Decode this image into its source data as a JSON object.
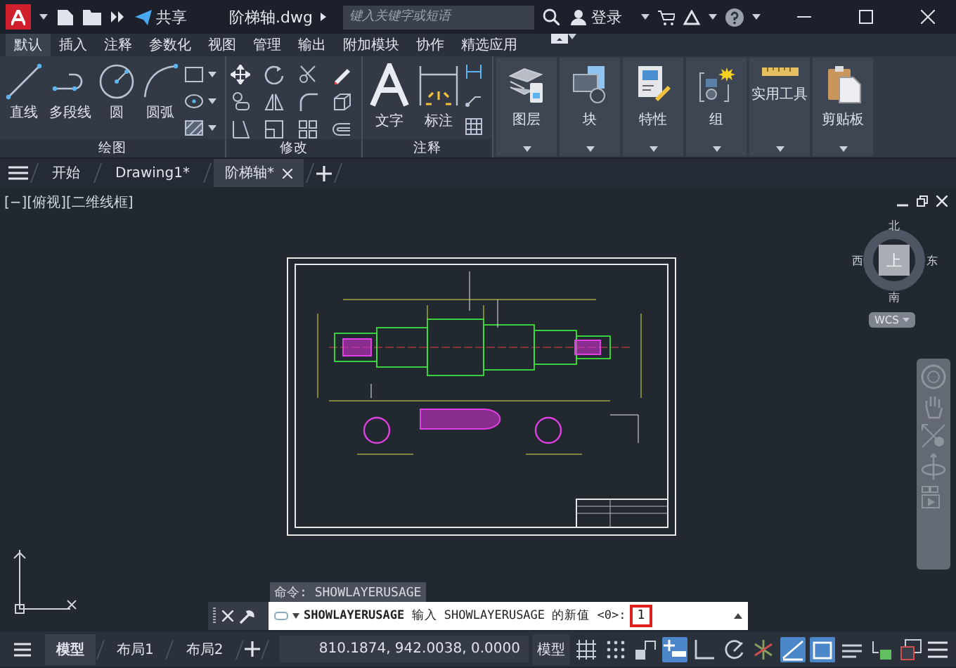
{
  "title_bar": {
    "share": "共享",
    "file_name": "阶梯轴.dwg",
    "search": {
      "placeholder": "键入关键字或短语"
    },
    "sign_in": "登录"
  },
  "ribbon_tabs": [
    {
      "label": "默认",
      "selected": true
    },
    {
      "label": "插入",
      "selected": false
    },
    {
      "label": "注释",
      "selected": false
    },
    {
      "label": "参数化",
      "selected": false
    },
    {
      "label": "视图",
      "selected": false
    },
    {
      "label": "管理",
      "selected": false
    },
    {
      "label": "输出",
      "selected": false
    },
    {
      "label": "附加模块",
      "selected": false
    },
    {
      "label": "协作",
      "selected": false
    },
    {
      "label": "精选应用",
      "selected": false
    }
  ],
  "draw_panel": {
    "title": "绘图",
    "tools": [
      {
        "kind": "line",
        "label": "直线"
      },
      {
        "kind": "polyline",
        "label": "多段线"
      },
      {
        "kind": "circle",
        "label": "圆"
      },
      {
        "kind": "arc",
        "label": "圆弧"
      }
    ]
  },
  "modify_panel": {
    "title": "修改"
  },
  "annotation_panel": {
    "title": "注释",
    "tools": [
      {
        "kind": "text",
        "label": "文字"
      },
      {
        "kind": "dimension",
        "label": "标注"
      }
    ]
  },
  "ribbon_buttons": [
    {
      "kind": "layers",
      "label": "图层"
    },
    {
      "kind": "block",
      "label": "块"
    },
    {
      "kind": "properties",
      "label": "特性"
    },
    {
      "kind": "group",
      "label": "组"
    },
    {
      "kind": "utilities",
      "label": "实用工具"
    },
    {
      "kind": "clipboard",
      "label": "剪贴板"
    }
  ],
  "doc_tabs": [
    {
      "label": "开始",
      "selected": false
    },
    {
      "label": "Drawing1*",
      "selected": false
    },
    {
      "label": "阶梯轴*",
      "selected": true
    }
  ],
  "viewport_label": "[−][俯视][二维线框]",
  "viewcube": {
    "north": "北",
    "west": "西",
    "face": "上",
    "east": "东",
    "south": "南",
    "ucs": "WCS"
  },
  "command_history": "命令: SHOWLAYERUSAGE",
  "command_line": {
    "prompt": "**SHOWLAYERUSAGE** 输入 SHOWLAYERUSAGE 的新值 <0>:",
    "value": "1"
  },
  "layout_tabs": [
    {
      "label": "模型",
      "selected": true
    },
    {
      "label": "布局1",
      "selected": false
    },
    {
      "label": "布局2",
      "selected": false
    }
  ],
  "status_bar": {
    "coordinates": "810.1874, 942.0038, 0.0000",
    "space": "模型"
  },
  "status_toggles": [
    {
      "kind": "grid",
      "on": false
    },
    {
      "kind": "snap",
      "on": false
    },
    {
      "kind": "dynamic",
      "on": false
    },
    {
      "kind": "infer",
      "on": true
    },
    {
      "kind": "ortho",
      "on": false
    },
    {
      "kind": "polar",
      "on": false
    },
    {
      "kind": "isodraft",
      "on": false
    },
    {
      "kind": "lineweight",
      "on": true
    },
    {
      "kind": "transparency",
      "on": true
    },
    {
      "kind": "cycling",
      "on": false
    },
    {
      "kind": "monitor",
      "on": false
    },
    {
      "kind": "isolate",
      "on": false
    }
  ]
}
